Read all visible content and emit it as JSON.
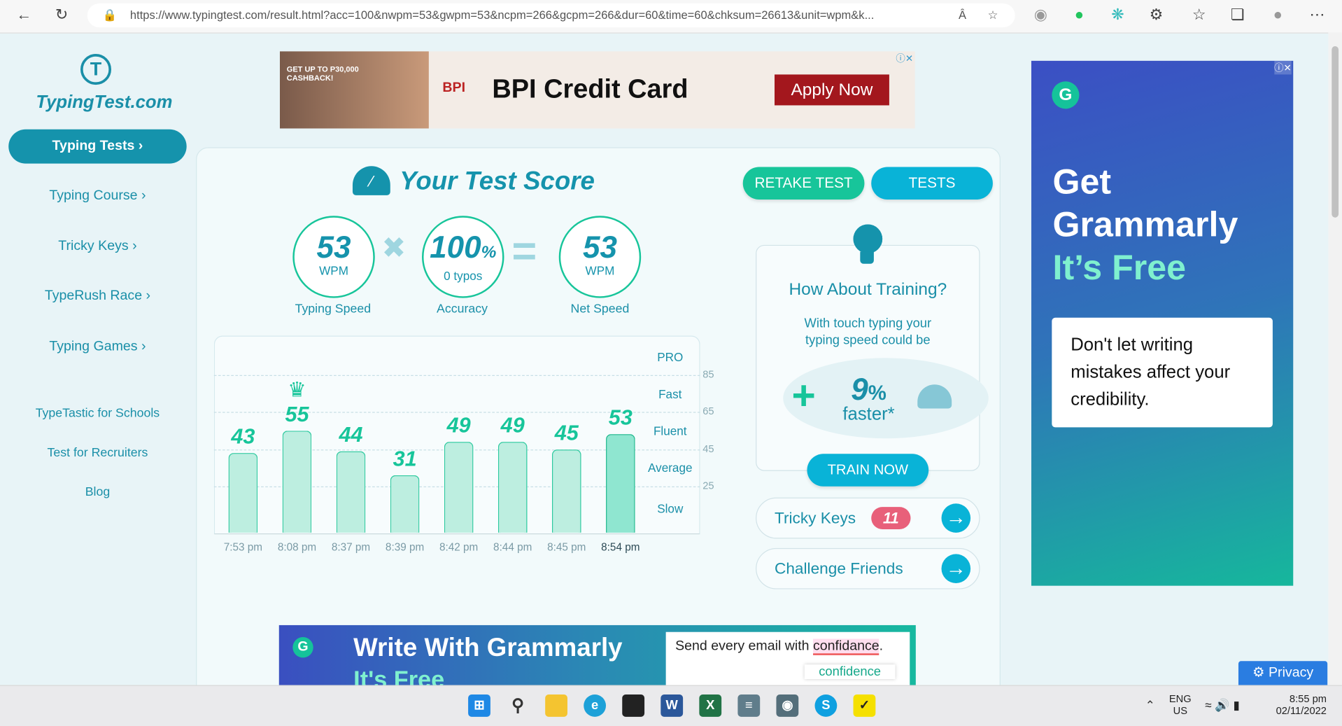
{
  "browser": {
    "url": "https://www.typingtest.com/result.html?acc=100&nwpm=53&gwpm=53&ncpm=266&gcpm=266&dur=60&time=60&chksum=26613&unit=wpm&k...",
    "read_aloud": "Â"
  },
  "sidebar": {
    "logo": "TypingTest.com",
    "primary": "Typing Tests",
    "items": [
      "Typing Course",
      "Tricky Keys",
      "TypeRush Race",
      "Typing Games"
    ],
    "links": [
      "TypeTastic for Schools",
      "Test for Recruiters",
      "Blog"
    ]
  },
  "ad_top": {
    "tag": "GET UP TO P30,000 CASHBACK!",
    "brand": "BPI",
    "title": "BPI Credit Card",
    "cta": "Apply Now"
  },
  "score": {
    "title": "Your Test Score",
    "retake": "RETAKE TEST",
    "tests": "TESTS",
    "speed": {
      "value": "53",
      "unit": "WPM",
      "label": "Typing Speed"
    },
    "accuracy": {
      "value": "100",
      "pct": "%",
      "typos": "0  typos",
      "label": "Accuracy"
    },
    "net": {
      "value": "53",
      "unit": "WPM",
      "label": "Net Speed"
    },
    "times_sign": "✖",
    "equals_sign": "="
  },
  "chart_data": {
    "type": "bar",
    "categories": [
      "7:53 pm",
      "8:08 pm",
      "8:37 pm",
      "8:39 pm",
      "8:42 pm",
      "8:44 pm",
      "8:45 pm",
      "8:54 pm"
    ],
    "values": [
      43,
      55,
      44,
      31,
      49,
      49,
      45,
      53
    ],
    "labels": [
      "43",
      "55",
      "44",
      "31",
      "49",
      "49",
      "45",
      "53"
    ],
    "best_index": 1,
    "current_index": 7,
    "yticks": [
      "85",
      "65",
      "45",
      "25"
    ],
    "ytick_values": [
      85,
      65,
      45,
      25
    ],
    "bands": [
      "PRO",
      "Fast",
      "Fluent",
      "Average",
      "Slow"
    ],
    "ylim": [
      0,
      106
    ]
  },
  "training": {
    "title": "How About Training?",
    "text1": "With touch typing your",
    "text2": "typing speed could be",
    "plus": "+",
    "pct": "9",
    "pct_sign": "%",
    "faster": "faster*",
    "cta": "TRAIN NOW"
  },
  "tricky": {
    "label": "Tricky Keys",
    "count": "11"
  },
  "challenge": {
    "label": "Challenge Friends"
  },
  "ad_right": {
    "l1": "Get",
    "l2": "Grammarly",
    "l3": "It’s Free",
    "body": "Don't let writing mistakes affect your credibility."
  },
  "ad_bottom": {
    "title": "Write With Grammarly",
    "sub": "It's Free",
    "email_pre": "Send every email with ",
    "email_word": "confidance",
    "email_post": ".",
    "suggestion": "confidence"
  },
  "privacy": "Privacy",
  "taskbar": {
    "lang1": "ENG",
    "lang2": "US",
    "time": "8:55 pm",
    "date": "02/11/2022"
  }
}
